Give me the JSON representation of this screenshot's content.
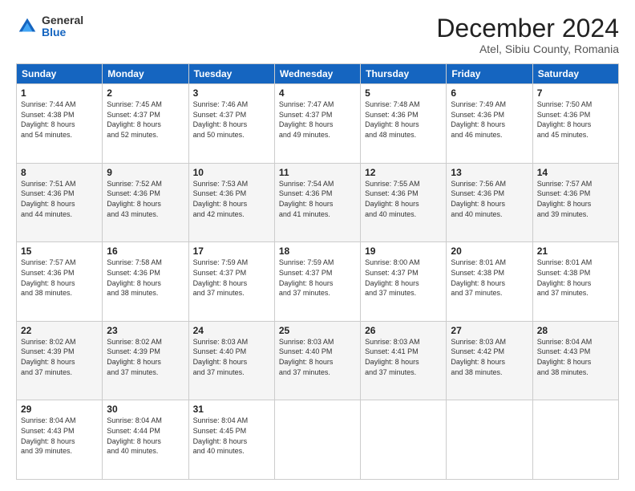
{
  "logo": {
    "general": "General",
    "blue": "Blue"
  },
  "header": {
    "month": "December 2024",
    "location": "Atel, Sibiu County, Romania"
  },
  "weekdays": [
    "Sunday",
    "Monday",
    "Tuesday",
    "Wednesday",
    "Thursday",
    "Friday",
    "Saturday"
  ],
  "weeks": [
    [
      {
        "day": "1",
        "info": "Sunrise: 7:44 AM\nSunset: 4:38 PM\nDaylight: 8 hours\nand 54 minutes."
      },
      {
        "day": "2",
        "info": "Sunrise: 7:45 AM\nSunset: 4:37 PM\nDaylight: 8 hours\nand 52 minutes."
      },
      {
        "day": "3",
        "info": "Sunrise: 7:46 AM\nSunset: 4:37 PM\nDaylight: 8 hours\nand 50 minutes."
      },
      {
        "day": "4",
        "info": "Sunrise: 7:47 AM\nSunset: 4:37 PM\nDaylight: 8 hours\nand 49 minutes."
      },
      {
        "day": "5",
        "info": "Sunrise: 7:48 AM\nSunset: 4:36 PM\nDaylight: 8 hours\nand 48 minutes."
      },
      {
        "day": "6",
        "info": "Sunrise: 7:49 AM\nSunset: 4:36 PM\nDaylight: 8 hours\nand 46 minutes."
      },
      {
        "day": "7",
        "info": "Sunrise: 7:50 AM\nSunset: 4:36 PM\nDaylight: 8 hours\nand 45 minutes."
      }
    ],
    [
      {
        "day": "8",
        "info": "Sunrise: 7:51 AM\nSunset: 4:36 PM\nDaylight: 8 hours\nand 44 minutes."
      },
      {
        "day": "9",
        "info": "Sunrise: 7:52 AM\nSunset: 4:36 PM\nDaylight: 8 hours\nand 43 minutes."
      },
      {
        "day": "10",
        "info": "Sunrise: 7:53 AM\nSunset: 4:36 PM\nDaylight: 8 hours\nand 42 minutes."
      },
      {
        "day": "11",
        "info": "Sunrise: 7:54 AM\nSunset: 4:36 PM\nDaylight: 8 hours\nand 41 minutes."
      },
      {
        "day": "12",
        "info": "Sunrise: 7:55 AM\nSunset: 4:36 PM\nDaylight: 8 hours\nand 40 minutes."
      },
      {
        "day": "13",
        "info": "Sunrise: 7:56 AM\nSunset: 4:36 PM\nDaylight: 8 hours\nand 40 minutes."
      },
      {
        "day": "14",
        "info": "Sunrise: 7:57 AM\nSunset: 4:36 PM\nDaylight: 8 hours\nand 39 minutes."
      }
    ],
    [
      {
        "day": "15",
        "info": "Sunrise: 7:57 AM\nSunset: 4:36 PM\nDaylight: 8 hours\nand 38 minutes."
      },
      {
        "day": "16",
        "info": "Sunrise: 7:58 AM\nSunset: 4:36 PM\nDaylight: 8 hours\nand 38 minutes."
      },
      {
        "day": "17",
        "info": "Sunrise: 7:59 AM\nSunset: 4:37 PM\nDaylight: 8 hours\nand 37 minutes."
      },
      {
        "day": "18",
        "info": "Sunrise: 7:59 AM\nSunset: 4:37 PM\nDaylight: 8 hours\nand 37 minutes."
      },
      {
        "day": "19",
        "info": "Sunrise: 8:00 AM\nSunset: 4:37 PM\nDaylight: 8 hours\nand 37 minutes."
      },
      {
        "day": "20",
        "info": "Sunrise: 8:01 AM\nSunset: 4:38 PM\nDaylight: 8 hours\nand 37 minutes."
      },
      {
        "day": "21",
        "info": "Sunrise: 8:01 AM\nSunset: 4:38 PM\nDaylight: 8 hours\nand 37 minutes."
      }
    ],
    [
      {
        "day": "22",
        "info": "Sunrise: 8:02 AM\nSunset: 4:39 PM\nDaylight: 8 hours\nand 37 minutes."
      },
      {
        "day": "23",
        "info": "Sunrise: 8:02 AM\nSunset: 4:39 PM\nDaylight: 8 hours\nand 37 minutes."
      },
      {
        "day": "24",
        "info": "Sunrise: 8:03 AM\nSunset: 4:40 PM\nDaylight: 8 hours\nand 37 minutes."
      },
      {
        "day": "25",
        "info": "Sunrise: 8:03 AM\nSunset: 4:40 PM\nDaylight: 8 hours\nand 37 minutes."
      },
      {
        "day": "26",
        "info": "Sunrise: 8:03 AM\nSunset: 4:41 PM\nDaylight: 8 hours\nand 37 minutes."
      },
      {
        "day": "27",
        "info": "Sunrise: 8:03 AM\nSunset: 4:42 PM\nDaylight: 8 hours\nand 38 minutes."
      },
      {
        "day": "28",
        "info": "Sunrise: 8:04 AM\nSunset: 4:43 PM\nDaylight: 8 hours\nand 38 minutes."
      }
    ],
    [
      {
        "day": "29",
        "info": "Sunrise: 8:04 AM\nSunset: 4:43 PM\nDaylight: 8 hours\nand 39 minutes."
      },
      {
        "day": "30",
        "info": "Sunrise: 8:04 AM\nSunset: 4:44 PM\nDaylight: 8 hours\nand 40 minutes."
      },
      {
        "day": "31",
        "info": "Sunrise: 8:04 AM\nSunset: 4:45 PM\nDaylight: 8 hours\nand 40 minutes."
      },
      {
        "day": "",
        "info": ""
      },
      {
        "day": "",
        "info": ""
      },
      {
        "day": "",
        "info": ""
      },
      {
        "day": "",
        "info": ""
      }
    ]
  ]
}
